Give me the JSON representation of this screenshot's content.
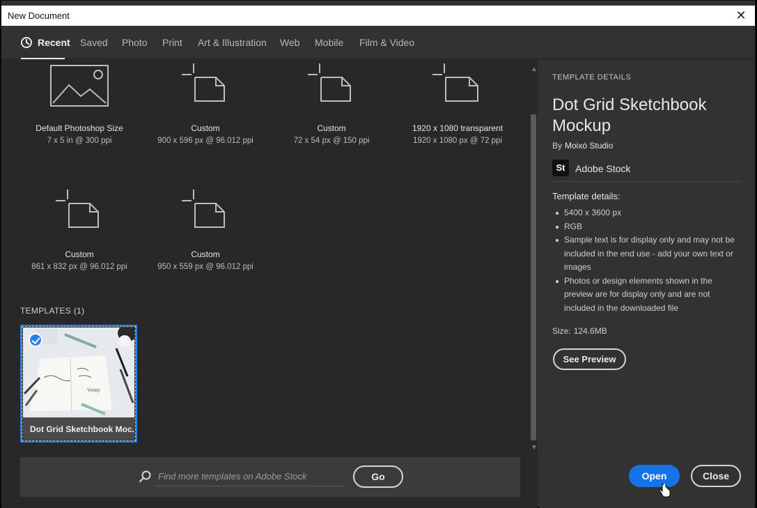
{
  "window": {
    "title": "New Document"
  },
  "tabs": [
    {
      "label": "Recent",
      "active": true
    },
    {
      "label": "Saved"
    },
    {
      "label": "Photo"
    },
    {
      "label": "Print"
    },
    {
      "label": "Art & Illustration"
    },
    {
      "label": "Web"
    },
    {
      "label": "Mobile"
    },
    {
      "label": "Film & Video"
    }
  ],
  "presets": [
    {
      "name": "Default Photoshop Size",
      "dims": "7 x 5 in @ 300 ppi",
      "icon": "image-placeholder-icon"
    },
    {
      "name": "Custom",
      "dims": "900 x 596 px @ 96.012 ppi",
      "icon": "custom-document-icon"
    },
    {
      "name": "Custom",
      "dims": "72 x 54 px @ 150 ppi",
      "icon": "custom-document-icon"
    },
    {
      "name": "1920 x 1080 transparent",
      "dims": "1920 x 1080 px @ 72 ppi",
      "icon": "custom-document-icon"
    },
    {
      "name": "Custom",
      "dims": "861 x 832 px @ 96.012 ppi",
      "icon": "custom-document-icon"
    },
    {
      "name": "Custom",
      "dims": "950 x 559 px @ 96.012 ppi",
      "icon": "custom-document-icon"
    }
  ],
  "templates": {
    "label": "TEMPLATES",
    "count": "(1)",
    "items": [
      {
        "caption": "Dot Grid Sketchbook Moc...",
        "selected": true
      }
    ]
  },
  "search": {
    "placeholder": "Find more templates on Adobe Stock",
    "go_label": "Go"
  },
  "details": {
    "heading": "TEMPLATE DETAILS",
    "title": "Dot Grid Sketchbook Mockup",
    "by_label": "By",
    "author": "Moixó Studio",
    "provider": "Adobe Stock",
    "provider_logo": "St",
    "section_label": "Template details:",
    "items": [
      "5400 x 3600 px",
      "RGB",
      "Sample text is for display only and may not be included in the end use - add your own text or images",
      "Photos or design elements shown in the preview are for display only and are not included in the downloaded file"
    ],
    "size_label": "Size:",
    "size_value": "124.6MB",
    "preview_label": "See Preview"
  },
  "actions": {
    "open_label": "Open",
    "close_label": "Close"
  },
  "colors": {
    "accent": "#1473e6",
    "selection": "#2b7de9",
    "panel": "#323232",
    "canvas": "#282828"
  }
}
